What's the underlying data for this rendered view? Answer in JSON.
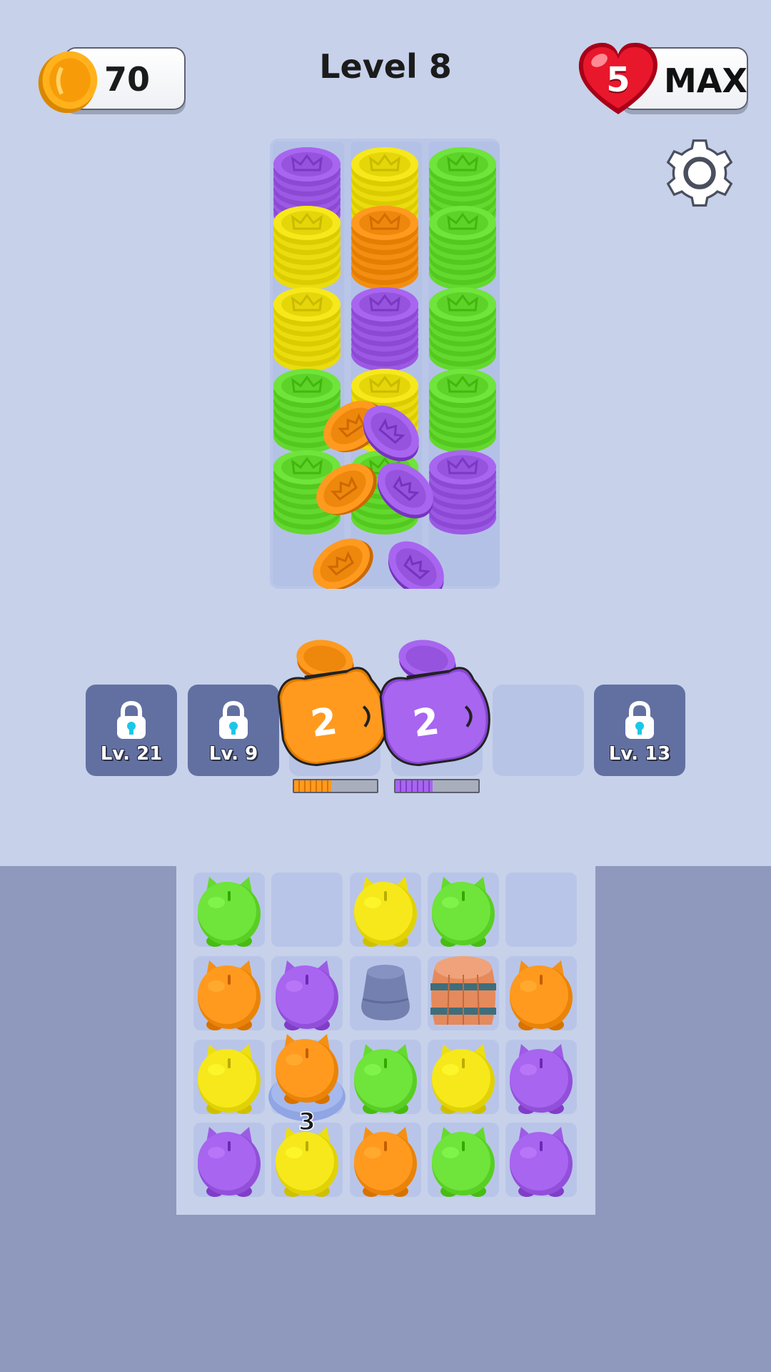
{
  "hud": {
    "coins": "70",
    "level_title": "Level 8",
    "lives": "5",
    "lives_status": "MAX"
  },
  "icons": {
    "coin": "gold-coin-icon",
    "heart": "heart-icon",
    "settings": "gear-icon",
    "lock": "padlock-icon"
  },
  "colors": {
    "purple": "#a865f0",
    "yellow": "#f6e81a",
    "green": "#6fe43a",
    "orange": "#ff9a1f",
    "background": "#c7d1ea",
    "floor": "#8f99bd",
    "locked_slot": "#6270a1"
  },
  "coin_tray": {
    "columns": [
      {
        "stacks": [
          "purple",
          "yellow",
          "yellow",
          "green",
          "green"
        ]
      },
      {
        "stacks": [
          "yellow",
          "orange",
          "purple",
          "yellow",
          "green"
        ]
      },
      {
        "stacks": [
          "green",
          "green",
          "green",
          "green",
          "purple"
        ]
      }
    ],
    "flying_coins": [
      "orange",
      "purple",
      "orange",
      "purple",
      "orange",
      "purple"
    ]
  },
  "slots": [
    {
      "state": "locked",
      "label": "Lv. 21"
    },
    {
      "state": "locked",
      "label": "Lv. 9"
    },
    {
      "state": "filled",
      "pig_color": "orange",
      "count": "2",
      "progress": 0.45
    },
    {
      "state": "filled",
      "pig_color": "purple",
      "count": "2",
      "progress": 0.45
    },
    {
      "state": "empty"
    },
    {
      "state": "locked",
      "label": "Lv. 13"
    }
  ],
  "board": {
    "rows": [
      [
        "green",
        "empty",
        "yellow",
        "green",
        "empty"
      ],
      [
        "orange",
        "purple",
        "hidden-pig",
        "barrel",
        "orange"
      ],
      [
        "yellow",
        "orange-on-pedestal",
        "green",
        "yellow",
        "purple"
      ],
      [
        "purple",
        "yellow",
        "orange",
        "green",
        "purple"
      ]
    ],
    "pedestal_count": "3"
  }
}
